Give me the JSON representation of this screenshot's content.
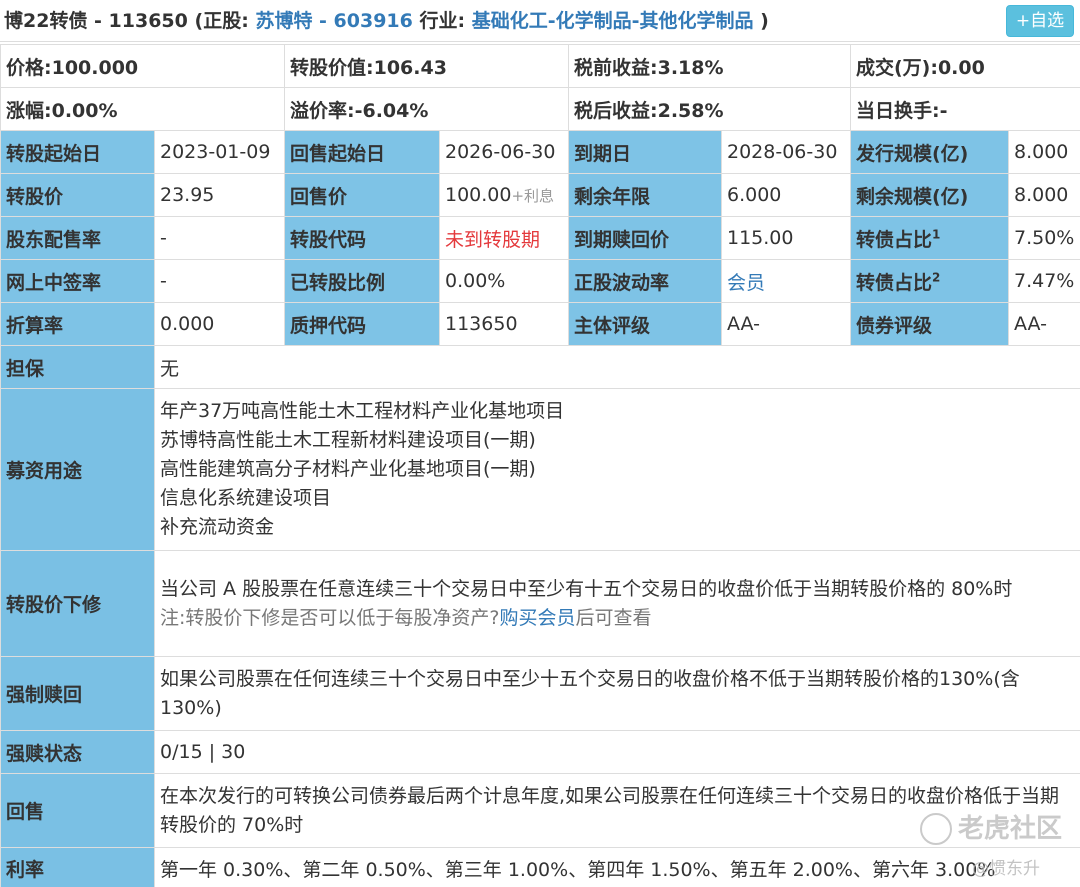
{
  "header": {
    "bond_name": "博22转债 - 113650",
    "stock_prefix": "(正股:",
    "stock_link": "苏博特 - 603916",
    "industry_prefix": "行业:",
    "industry_link": "基础化工-化学制品-其他化学制品",
    "close_paren": ")",
    "add_button": "+自选"
  },
  "summary": {
    "price": "价格:100.000",
    "conv_value": "转股价值:106.43",
    "pretax_yield": "税前收益:3.18%",
    "volume": "成交(万):0.00",
    "change": "涨幅:0.00%",
    "premium": "溢价率:-6.04%",
    "aftertax_yield": "税后收益:2.58%",
    "turnover": "当日换手:-"
  },
  "details": {
    "r1": [
      "转股起始日",
      "2023-01-09",
      "回售起始日",
      "2026-06-30",
      "到期日",
      "2028-06-30",
      "发行规模(亿)",
      "8.000"
    ],
    "r2": [
      "转股价",
      "23.95",
      "回售价",
      "100.00",
      "+利息",
      "剩余年限",
      "6.000",
      "剩余规模(亿)",
      "8.000"
    ],
    "r3": [
      "股东配售率",
      "-",
      "转股代码",
      "未到转股期",
      "到期赎回价",
      "115.00",
      "转债占比",
      "1",
      "7.50%"
    ],
    "r4": [
      "网上中签率",
      "-",
      "已转股比例",
      "0.00%",
      "正股波动率",
      "会员",
      "转债占比",
      "2",
      "7.47%"
    ],
    "r5": [
      "折算率",
      "0.000",
      "质押代码",
      "113650",
      "主体评级",
      "AA-",
      "债券评级",
      "AA-"
    ]
  },
  "terms": {
    "guarantee_label": "担保",
    "guarantee_value": "无",
    "use_label": "募资用途",
    "use_items": [
      "年产37万吨高性能土木工程材料产业化基地项目",
      "苏博特高性能土木工程新材料建设项目(一期)",
      "高性能建筑高分子材料产业化基地项目(一期)",
      "信息化系统建设项目",
      "补充流动资金"
    ],
    "downward_label": "转股价下修",
    "downward_text": "当公司 A 股股票在任意连续三十个交易日中至少有十五个交易日的收盘价低于当期转股价格的 80%时",
    "downward_note_prefix": "注:转股价下修是否可以低于每股净资产?",
    "downward_note_link": "购买会员",
    "downward_note_suffix": "后可查看",
    "force_label": "强制赎回",
    "force_text": "如果公司股票在任何连续三十个交易日中至少十五个交易日的收盘价格不低于当期转股价格的130%(含 130%)",
    "force_status_label": "强赎状态",
    "force_status_value": "0/15 | 30",
    "putback_label": "回售",
    "putback_text": "在本次发行的可转换公司债券最后两个计息年度,如果公司股票在任何连续三十个交易日的收盘价格低于当期转股价的 70%时",
    "rate_label": "利率",
    "rate_text": "第一年 0.30%、第二年 0.50%、第三年 1.00%、第四年 1.50%、第五年 2.00%、第六年 3.00%"
  },
  "watermark": {
    "brand": "老虎社区",
    "user": "@惯东升"
  }
}
